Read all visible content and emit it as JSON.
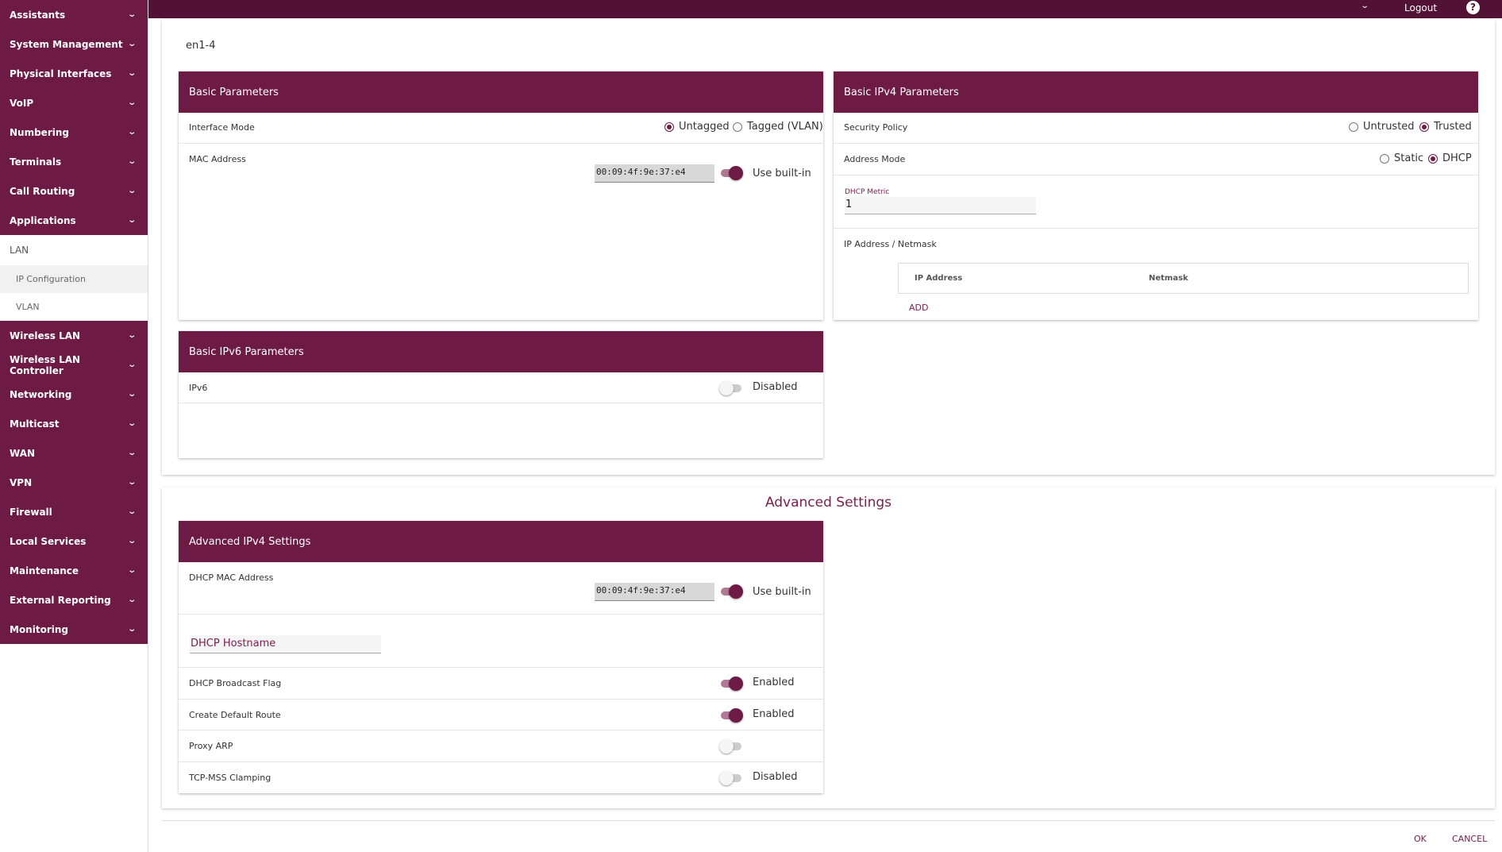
{
  "sidebar": {
    "items_top": [
      {
        "label": "Assistants"
      },
      {
        "label": "System Management"
      },
      {
        "label": "Physical Interfaces"
      },
      {
        "label": "VoIP"
      },
      {
        "label": "Numbering"
      },
      {
        "label": "Terminals"
      },
      {
        "label": "Call Routing"
      },
      {
        "label": "Applications"
      }
    ],
    "lan": {
      "label": "LAN",
      "sub": [
        "IP Configuration",
        "VLAN"
      ]
    },
    "items_bottom": [
      {
        "label": "Wireless LAN"
      },
      {
        "label": "Wireless LAN Controller"
      },
      {
        "label": "Networking"
      },
      {
        "label": "Multicast"
      },
      {
        "label": "WAN"
      },
      {
        "label": "VPN"
      },
      {
        "label": "Firewall"
      },
      {
        "label": "Local Services"
      },
      {
        "label": "Maintenance"
      },
      {
        "label": "External Reporting"
      },
      {
        "label": "Monitoring"
      }
    ]
  },
  "topbar": {
    "logout": "Logout",
    "help": "?"
  },
  "page": {
    "title": "en1-4"
  },
  "basic": {
    "title": "Basic Parameters",
    "interface_mode": {
      "label": "Interface Mode",
      "opt1": "Untagged",
      "opt2": "Tagged (VLAN)",
      "selected": "Untagged"
    },
    "mac": {
      "label": "MAC Address",
      "value": "00:09:4f:9e:37:e4",
      "toggle_label": "Use built-in",
      "toggle_on": true
    }
  },
  "ipv4": {
    "title": "Basic IPv4 Parameters",
    "security": {
      "label": "Security Policy",
      "opt1": "Untrusted",
      "opt2": "Trusted",
      "selected": "Trusted"
    },
    "address_mode": {
      "label": "Address Mode",
      "opt1": "Static",
      "opt2": "DHCP",
      "selected": "DHCP"
    },
    "dhcp_metric": {
      "label": "DHCP Metric",
      "value": "1"
    },
    "ip_netmask": {
      "label": "IP Address / Netmask",
      "col1": "IP Address",
      "col2": "Netmask",
      "add": "ADD"
    }
  },
  "ipv6": {
    "title": "Basic IPv6 Parameters",
    "ipv6": {
      "label": "IPv6",
      "toggle_label": "Disabled",
      "toggle_on": false
    }
  },
  "advanced": {
    "title": "Advanced Settings",
    "card_title": "Advanced IPv4 Settings",
    "dhcp_mac": {
      "label": "DHCP MAC Address",
      "value": "00:09:4f:9e:37:e4",
      "toggle_label": "Use built-in",
      "toggle_on": true
    },
    "dhcp_hostname": {
      "placeholder": "DHCP Hostname"
    },
    "broadcast": {
      "label": "DHCP Broadcast Flag",
      "toggle_label": "Enabled",
      "toggle_on": true
    },
    "default_route": {
      "label": "Create Default Route",
      "toggle_label": "Enabled",
      "toggle_on": true
    },
    "proxy_arp": {
      "label": "Proxy ARP",
      "toggle_label": "",
      "toggle_on": false
    },
    "tcp_mss": {
      "label": "TCP-MSS Clamping",
      "toggle_label": "Disabled",
      "toggle_on": false
    }
  },
  "footer": {
    "ok": "OK",
    "cancel": "CANCEL"
  },
  "colors": {
    "brand": "#6d1a45",
    "topbar": "#521235",
    "accent_text": "#7a2050"
  }
}
